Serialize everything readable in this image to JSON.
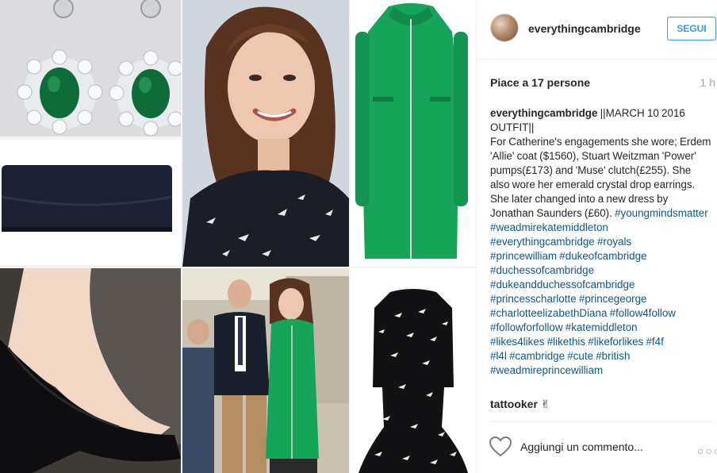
{
  "post": {
    "username": "everythingcambridge",
    "follow_label": "SEGUI",
    "likes_text": "Piace a 17 persone",
    "time_text": "1 h",
    "caption_author": "everythingcambridge",
    "caption_text": "||MARCH 10 2016\nOUTFIT||\nFor Catherine's engagements she wore; Erdem 'Allie' coat ($1560), Stuart Weitzman 'Power' pumps(£173) and 'Muse' clutch(£255). She also wore her emerald crystal drop earrings. She later changed into a new dress by Jonathan Saunders (£60). ",
    "hashtags": "#youngmindsmatter\n#weadmirekatemiddleton\n#everythingcambridge #royals\n#princewilliam #dukeofcambridge\n#duchessofcambridge\n#dukeandduchessofcambridge\n#princesscharlotte #princegeorge\n#charlotteelizabethDiana #follow4follow\n#followforfollow #katemiddleton\n#likes4likes #likethis #likeforlikes #f4f\n#l4l #cambridge #cute #british\n#weadmireprincewilliam",
    "comment_user": "tattooker",
    "comment_text": "✌",
    "add_comment_placeholder": "Aggiungi un commento...",
    "more_options": "○○○"
  },
  "icons": {
    "heart": "heart-outline-icon",
    "more": "more-options-icon"
  },
  "colors": {
    "link": "#125688",
    "follow_blue": "#3897f0",
    "coat_green": "#16a35a",
    "emerald": "#0f6b3a"
  }
}
